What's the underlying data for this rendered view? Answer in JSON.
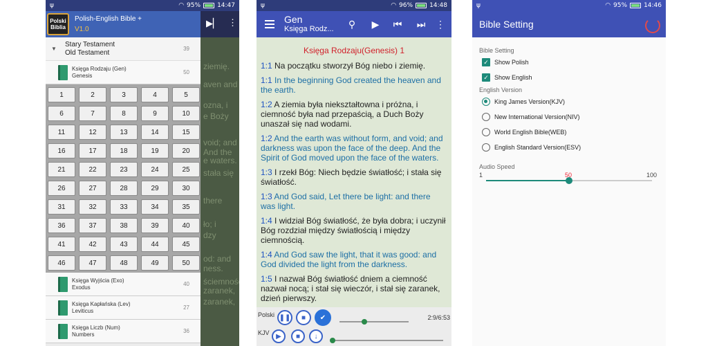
{
  "status": {
    "p1_time": "14:47",
    "p2_time": "14:48",
    "p3_time": "14:46",
    "battery": "95%",
    "battery2": "96%",
    "battery3": "95%"
  },
  "drawer": {
    "logo_line1": "Polski",
    "logo_line2": "Biblia",
    "title": "Polish-English Bible +",
    "version": "V1.0",
    "testament": {
      "line1": "Stary Testament",
      "line2": "Old Testament",
      "count": "39"
    },
    "books": [
      {
        "line1": "Księga Rodzaju (Gen)",
        "line2": "Genesis",
        "count": "50"
      },
      {
        "line1": "Księga Wyjścia (Exo)",
        "line2": "Exodus",
        "count": "40"
      },
      {
        "line1": "Księga Kapłańska (Lev)",
        "line2": "Leviticus",
        "count": "27"
      },
      {
        "line1": "Księga Liczb (Num)",
        "line2": "Numbers",
        "count": "36"
      }
    ],
    "chapters": [
      "1",
      "2",
      "3",
      "4",
      "5",
      "6",
      "7",
      "8",
      "9",
      "10",
      "11",
      "12",
      "13",
      "14",
      "15",
      "16",
      "17",
      "18",
      "19",
      "20",
      "21",
      "22",
      "23",
      "24",
      "25",
      "26",
      "27",
      "28",
      "29",
      "30",
      "31",
      "32",
      "33",
      "34",
      "35",
      "36",
      "37",
      "38",
      "39",
      "40",
      "41",
      "42",
      "43",
      "44",
      "45",
      "46",
      "47",
      "48",
      "49",
      "50"
    ]
  },
  "bg_fragments": [
    "ziemię.",
    "aven and",
    "ozna, i",
    "e Boży",
    "void; and",
    "And the",
    "e waters.",
    "stała się",
    "there",
    "ło; i",
    "dzy",
    "od: and",
    "ness.",
    "ściemność",
    "zaranek,",
    "zaranek,"
  ],
  "reader": {
    "book": "Gen",
    "subtitle": "Księga Rodz...",
    "chapter_title": "Księga Rodzaju(Genesis) 1",
    "verses": [
      {
        "num": "1:1",
        "text": " Na początku stworzył Bóg niebo i ziemię.",
        "lang": "pl"
      },
      {
        "num": "1:1",
        "text": " In the beginning God created the heaven and the earth.",
        "lang": "en"
      },
      {
        "num": "1:2",
        "text": " A ziemia była niekształtowna i próżna, i ciemność była nad przepaścią, a Duch Boży unaszał się nad wodami.",
        "lang": "pl"
      },
      {
        "num": "1:2",
        "text": " And the earth was without form, and void; and darkness was upon the face of the deep. And the Spirit of God moved upon the face of the waters.",
        "lang": "en"
      },
      {
        "num": "1:3",
        "text": " I rzekł Bóg: Niech będzie światłość; i stała się światłość.",
        "lang": "pl"
      },
      {
        "num": "1:3",
        "text": " And God said, Let there be light: and there was light.",
        "lang": "en"
      },
      {
        "num": "1:4",
        "text": " I widział Bóg światłość, że była dobra; i uczynił Bóg rozdział między światłością i między ciemnością.",
        "lang": "pl"
      },
      {
        "num": "1:4",
        "text": " And God saw the light, that it was good: and God divided the light from the darkness.",
        "lang": "en"
      },
      {
        "num": "1:5",
        "text": " I nazwał Bóg światłość dniem a ciemność nazwał nocą; i stał się wieczór, i stał się zaranek, dzień pierwszy.",
        "lang": "pl"
      }
    ],
    "player": {
      "polski_label": "Polski",
      "kjv_label": "KJV",
      "progress": "2:9/6:53",
      "progress_fraction": 0.36,
      "kjv_fraction": 0.0
    }
  },
  "settings": {
    "title": "Bible Setting",
    "section1": "Bible Setting",
    "show_polish": "Show Polish",
    "show_english": "Show English",
    "section2": "English Version",
    "versions": [
      "King James Version(KJV)",
      "New International Version(NIV)",
      "World English Bible(WEB)",
      "English Standard Version(ESV)"
    ],
    "selected_version": 0,
    "section3": "Audio Speed",
    "speed_min": "1",
    "speed_value": "50",
    "speed_max": "100"
  }
}
